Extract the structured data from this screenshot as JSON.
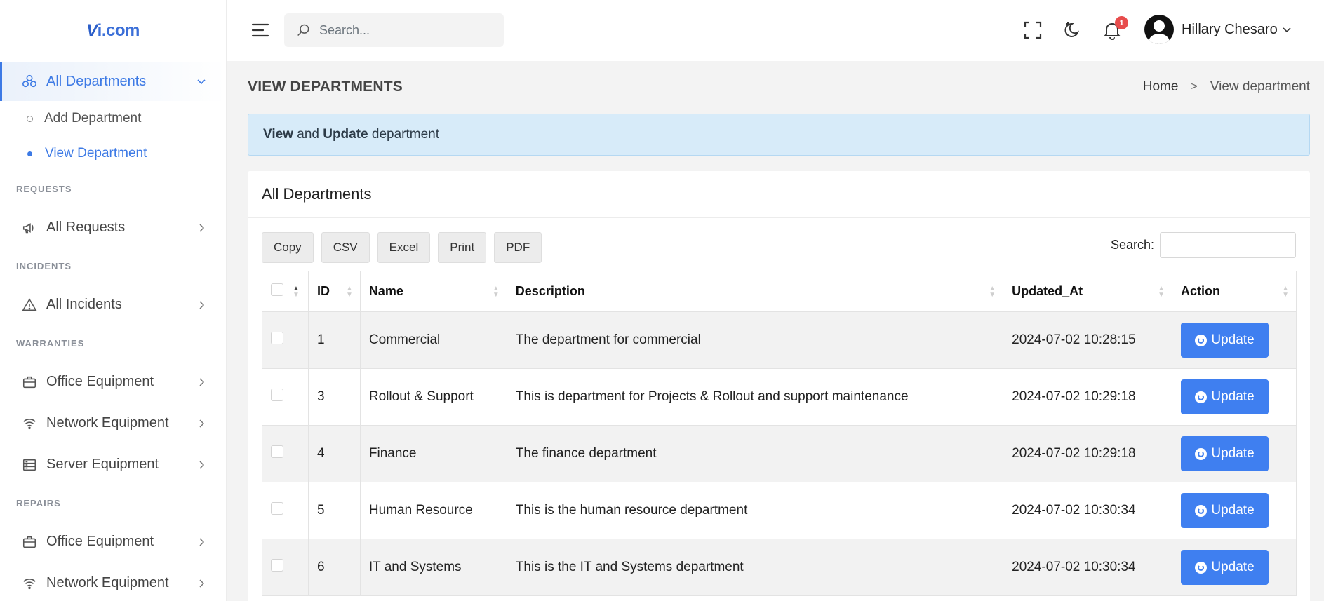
{
  "app": {
    "logo_prefix": "V",
    "logo_suffix": "i.com"
  },
  "sidebar": {
    "active": {
      "label": "All Departments",
      "icon": "departments-icon"
    },
    "subitems": [
      {
        "label": "Add Department",
        "active": false
      },
      {
        "label": "View Department",
        "active": true
      }
    ],
    "sections": [
      {
        "title": "REQUESTS",
        "items": [
          {
            "label": "All Requests",
            "icon": "megaphone-icon"
          }
        ]
      },
      {
        "title": "INCIDENTS",
        "items": [
          {
            "label": "All Incidents",
            "icon": "warning-icon"
          }
        ]
      },
      {
        "title": "WARRANTIES",
        "items": [
          {
            "label": "Office Equipment",
            "icon": "briefcase-icon"
          },
          {
            "label": "Network Equipment",
            "icon": "wifi-icon"
          },
          {
            "label": "Server Equipment",
            "icon": "server-icon"
          }
        ]
      },
      {
        "title": "REPAIRS",
        "items": [
          {
            "label": "Office Equipment",
            "icon": "briefcase-icon"
          },
          {
            "label": "Network Equipment",
            "icon": "wifi-icon"
          }
        ]
      }
    ]
  },
  "header": {
    "search_placeholder": "Search...",
    "notification_count": "1",
    "user_name": "Hillary Chesaro"
  },
  "page": {
    "title": "VIEW DEPARTMENTS",
    "breadcrumb_home": "Home",
    "breadcrumb_sep": ">",
    "breadcrumb_current": "View department",
    "alert_view": "View",
    "alert_and": " and ",
    "alert_update": "Update",
    "alert_rest": " department"
  },
  "card": {
    "title": "All Departments",
    "buttons": [
      "Copy",
      "CSV",
      "Excel",
      "Print",
      "PDF"
    ],
    "search_label": "Search:",
    "columns": [
      "ID",
      "Name",
      "Description",
      "Updated_At",
      "Action"
    ],
    "rows": [
      {
        "id": "1",
        "name": "Commercial",
        "description": "The department for commercial",
        "updated_at": "2024-07-02 10:28:15",
        "action": "Update"
      },
      {
        "id": "3",
        "name": "Rollout & Support",
        "description": "This is department for Projects & Rollout and support maintenance",
        "updated_at": "2024-07-02 10:29:18",
        "action": "Update"
      },
      {
        "id": "4",
        "name": "Finance",
        "description": "The finance department",
        "updated_at": "2024-07-02 10:29:18",
        "action": "Update"
      },
      {
        "id": "5",
        "name": "Human Resource",
        "description": "This is the human resource department",
        "updated_at": "2024-07-02 10:30:34",
        "action": "Update"
      },
      {
        "id": "6",
        "name": "IT and Systems",
        "description": "This is the IT and Systems department",
        "updated_at": "2024-07-02 10:30:34",
        "action": "Update"
      }
    ]
  },
  "colors": {
    "accent": "#3d7ae5",
    "button": "#3f7ff0",
    "badge": "#e74c4c",
    "alert_bg": "#d7ebf9"
  }
}
